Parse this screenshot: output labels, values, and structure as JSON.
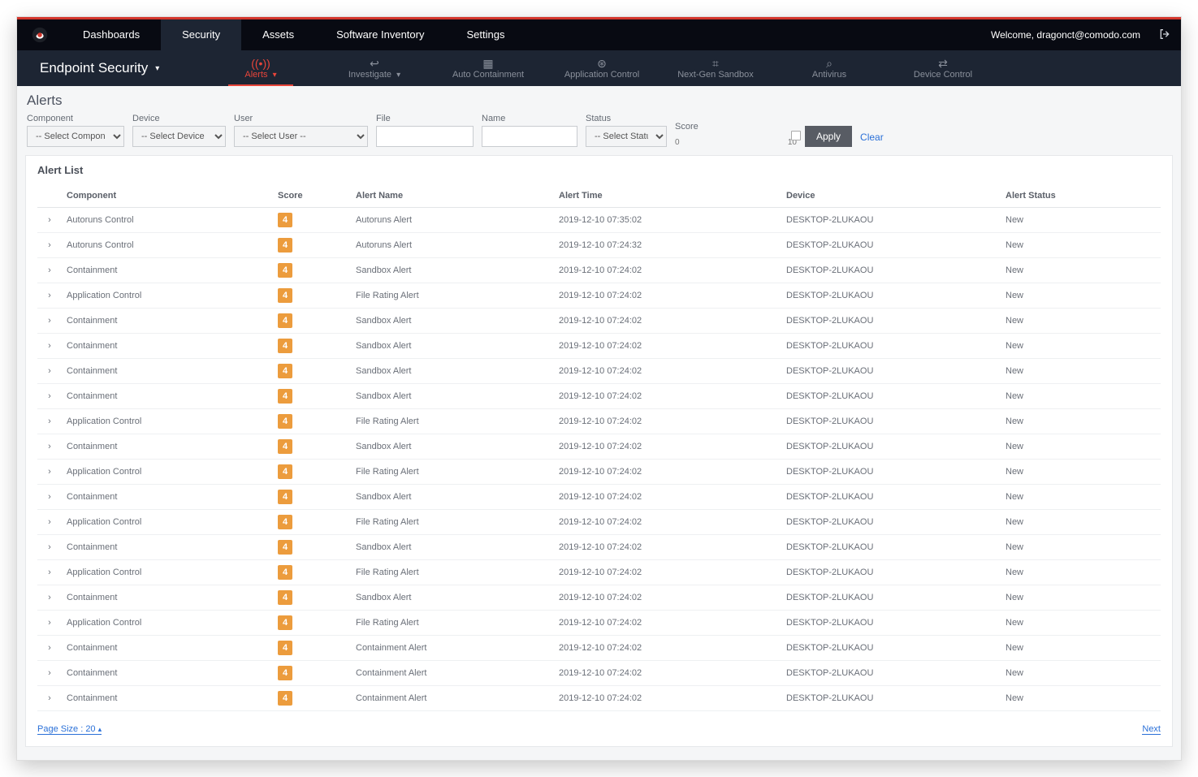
{
  "topnav": {
    "items": [
      "Dashboards",
      "Security",
      "Assets",
      "Software Inventory",
      "Settings"
    ],
    "active_index": 1,
    "welcome_prefix": "Welcome, ",
    "user_email": "dragonct@comodo.com"
  },
  "subnav": {
    "title": "Endpoint Security",
    "tabs": [
      {
        "label": "Alerts",
        "icon": "((•))",
        "active": true,
        "has_chevron": true
      },
      {
        "label": "Investigate",
        "icon": "↩",
        "active": false,
        "has_chevron": true
      },
      {
        "label": "Auto Containment",
        "icon": "▦",
        "active": false,
        "has_chevron": false
      },
      {
        "label": "Application Control",
        "icon": "⊛",
        "active": false,
        "has_chevron": false
      },
      {
        "label": "Next-Gen Sandbox",
        "icon": "⌗",
        "active": false,
        "has_chevron": false
      },
      {
        "label": "Antivirus",
        "icon": "⌕",
        "active": false,
        "has_chevron": false
      },
      {
        "label": "Device Control",
        "icon": "⇄",
        "active": false,
        "has_chevron": false
      }
    ]
  },
  "page": {
    "heading": "Alerts",
    "list_title": "Alert List"
  },
  "filters": {
    "component": {
      "label": "Component",
      "placeholder": "-- Select Component --"
    },
    "device": {
      "label": "Device",
      "placeholder": "-- Select Device --"
    },
    "user": {
      "label": "User",
      "placeholder": "-- Select User --"
    },
    "file": {
      "label": "File",
      "value": ""
    },
    "name": {
      "label": "Name",
      "value": ""
    },
    "status": {
      "label": "Status",
      "placeholder": "-- Select Status --"
    },
    "score": {
      "label": "Score",
      "min": "0",
      "max": "10"
    },
    "apply": "Apply",
    "clear": "Clear"
  },
  "columns": {
    "component": "Component",
    "score": "Score",
    "alert_name": "Alert Name",
    "alert_time": "Alert Time",
    "device": "Device",
    "alert_status": "Alert Status"
  },
  "rows": [
    {
      "component": "Autoruns Control",
      "score": "4",
      "alert_name": "Autoruns Alert",
      "alert_time": "2019-12-10 07:35:02",
      "device": "DESKTOP-2LUKAOU",
      "status": "New"
    },
    {
      "component": "Autoruns Control",
      "score": "4",
      "alert_name": "Autoruns Alert",
      "alert_time": "2019-12-10 07:24:32",
      "device": "DESKTOP-2LUKAOU",
      "status": "New"
    },
    {
      "component": "Containment",
      "score": "4",
      "alert_name": "Sandbox Alert",
      "alert_time": "2019-12-10 07:24:02",
      "device": "DESKTOP-2LUKAOU",
      "status": "New"
    },
    {
      "component": "Application Control",
      "score": "4",
      "alert_name": "File Rating Alert",
      "alert_time": "2019-12-10 07:24:02",
      "device": "DESKTOP-2LUKAOU",
      "status": "New"
    },
    {
      "component": "Containment",
      "score": "4",
      "alert_name": "Sandbox Alert",
      "alert_time": "2019-12-10 07:24:02",
      "device": "DESKTOP-2LUKAOU",
      "status": "New"
    },
    {
      "component": "Containment",
      "score": "4",
      "alert_name": "Sandbox Alert",
      "alert_time": "2019-12-10 07:24:02",
      "device": "DESKTOP-2LUKAOU",
      "status": "New"
    },
    {
      "component": "Containment",
      "score": "4",
      "alert_name": "Sandbox Alert",
      "alert_time": "2019-12-10 07:24:02",
      "device": "DESKTOP-2LUKAOU",
      "status": "New"
    },
    {
      "component": "Containment",
      "score": "4",
      "alert_name": "Sandbox Alert",
      "alert_time": "2019-12-10 07:24:02",
      "device": "DESKTOP-2LUKAOU",
      "status": "New"
    },
    {
      "component": "Application Control",
      "score": "4",
      "alert_name": "File Rating Alert",
      "alert_time": "2019-12-10 07:24:02",
      "device": "DESKTOP-2LUKAOU",
      "status": "New"
    },
    {
      "component": "Containment",
      "score": "4",
      "alert_name": "Sandbox Alert",
      "alert_time": "2019-12-10 07:24:02",
      "device": "DESKTOP-2LUKAOU",
      "status": "New"
    },
    {
      "component": "Application Control",
      "score": "4",
      "alert_name": "File Rating Alert",
      "alert_time": "2019-12-10 07:24:02",
      "device": "DESKTOP-2LUKAOU",
      "status": "New"
    },
    {
      "component": "Containment",
      "score": "4",
      "alert_name": "Sandbox Alert",
      "alert_time": "2019-12-10 07:24:02",
      "device": "DESKTOP-2LUKAOU",
      "status": "New"
    },
    {
      "component": "Application Control",
      "score": "4",
      "alert_name": "File Rating Alert",
      "alert_time": "2019-12-10 07:24:02",
      "device": "DESKTOP-2LUKAOU",
      "status": "New"
    },
    {
      "component": "Containment",
      "score": "4",
      "alert_name": "Sandbox Alert",
      "alert_time": "2019-12-10 07:24:02",
      "device": "DESKTOP-2LUKAOU",
      "status": "New"
    },
    {
      "component": "Application Control",
      "score": "4",
      "alert_name": "File Rating Alert",
      "alert_time": "2019-12-10 07:24:02",
      "device": "DESKTOP-2LUKAOU",
      "status": "New"
    },
    {
      "component": "Containment",
      "score": "4",
      "alert_name": "Sandbox Alert",
      "alert_time": "2019-12-10 07:24:02",
      "device": "DESKTOP-2LUKAOU",
      "status": "New"
    },
    {
      "component": "Application Control",
      "score": "4",
      "alert_name": "File Rating Alert",
      "alert_time": "2019-12-10 07:24:02",
      "device": "DESKTOP-2LUKAOU",
      "status": "New"
    },
    {
      "component": "Containment",
      "score": "4",
      "alert_name": "Containment Alert",
      "alert_time": "2019-12-10 07:24:02",
      "device": "DESKTOP-2LUKAOU",
      "status": "New"
    },
    {
      "component": "Containment",
      "score": "4",
      "alert_name": "Containment Alert",
      "alert_time": "2019-12-10 07:24:02",
      "device": "DESKTOP-2LUKAOU",
      "status": "New"
    },
    {
      "component": "Containment",
      "score": "4",
      "alert_name": "Containment Alert",
      "alert_time": "2019-12-10 07:24:02",
      "device": "DESKTOP-2LUKAOU",
      "status": "New"
    }
  ],
  "footer": {
    "page_size_label": "Page Size : 20",
    "next_label": "Next"
  }
}
